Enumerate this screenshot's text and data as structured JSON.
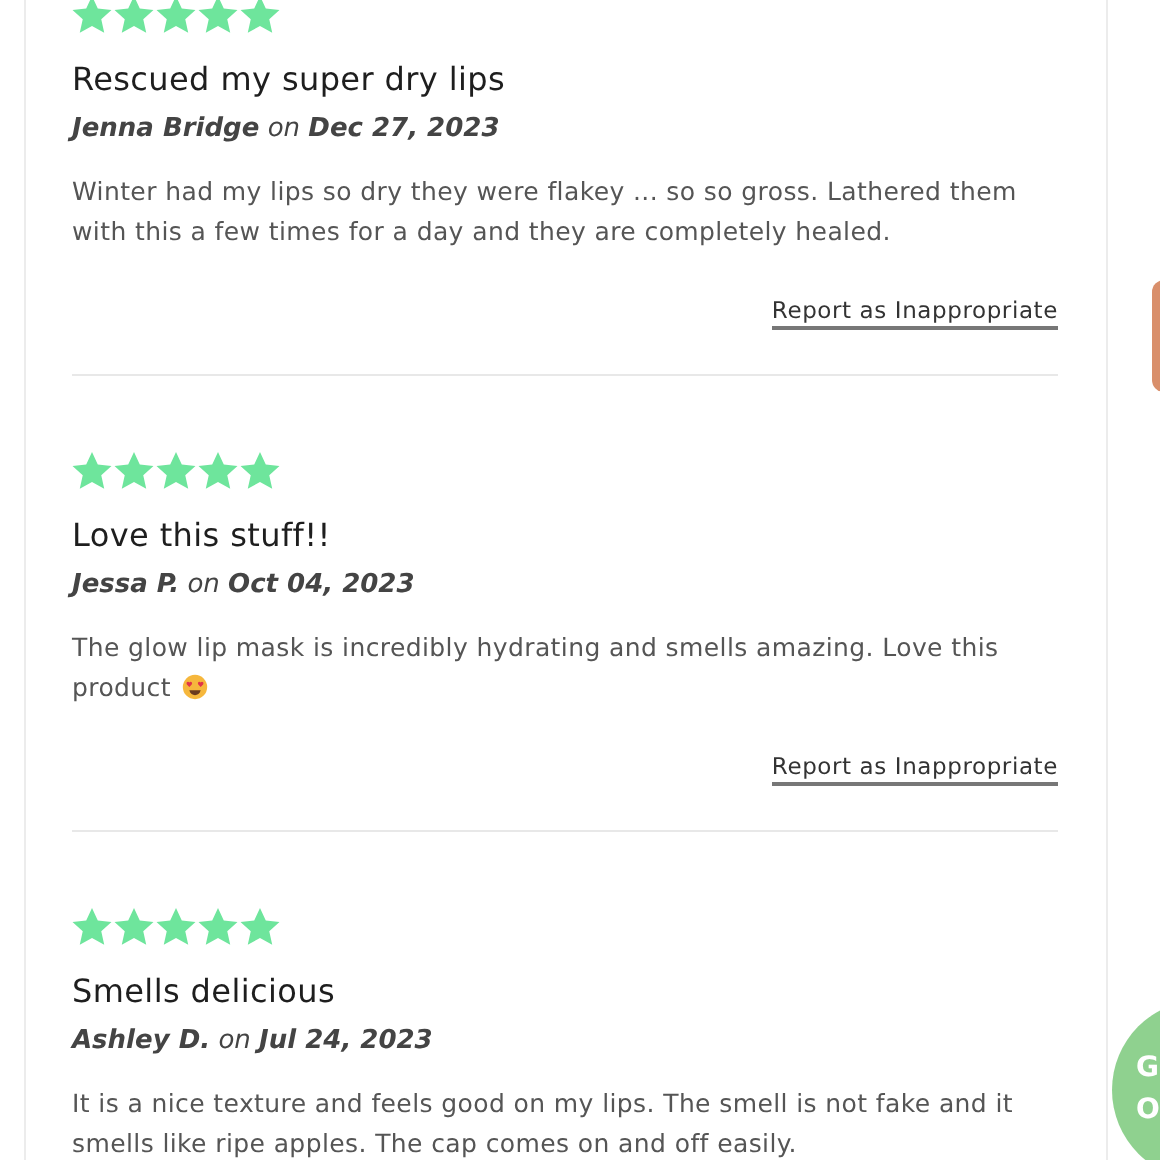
{
  "reviews": [
    {
      "stars": 5,
      "title": "Rescued my super dry lips",
      "author": "Jenna Bridge",
      "on": "on",
      "date": "Dec 27, 2023",
      "body": "Winter had my lips so dry they were flakey ... so so gross. Lathered them with this a few times for a day and they are completely healed.",
      "emoji": false,
      "report": "Report as Inappropriate"
    },
    {
      "stars": 5,
      "title": "Love this stuff!!",
      "author": "Jessa P.",
      "on": "on",
      "date": "Oct 04, 2023",
      "body": "The glow lip mask is incredibly hydrating and smells amazing. Love this product",
      "emoji": true,
      "report": "Report as Inappropriate"
    },
    {
      "stars": 5,
      "title": "Smells delicious",
      "author": "Ashley D.",
      "on": "on",
      "date": "Jul 24, 2023",
      "body": "It is a nice texture and feels good on my lips. The smell is not fake and it smells like ripe apples. The cap comes on and off easily.",
      "emoji": false
    }
  ],
  "floating_button": {
    "lines": [
      "G",
      "O"
    ]
  }
}
